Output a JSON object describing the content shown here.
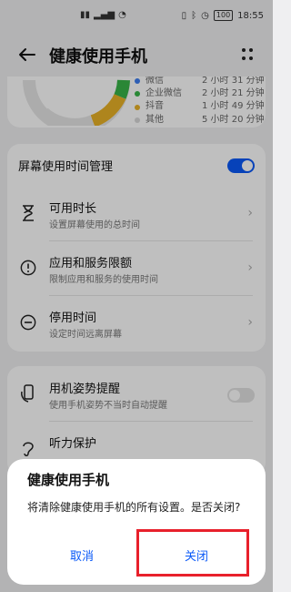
{
  "status_bar": {
    "left_icons": [
      "sim-icon",
      "signal-icon",
      "wifi-icon"
    ],
    "battery": "100",
    "time": "18:55"
  },
  "header": {
    "title": "健康使用手机",
    "back_icon": "back-arrow-icon",
    "more_icon": "more-icon"
  },
  "usage_legend": [
    {
      "name": "微信",
      "time": "2 小时 31 分钟",
      "color": "#3c7cf0"
    },
    {
      "name": "企业微信",
      "time": "2 小时 21 分钟",
      "color": "#38b449"
    },
    {
      "name": "抖音",
      "time": "1 小时 49 分钟",
      "color": "#e9b227"
    },
    {
      "name": "其他",
      "time": "5 小时 20 分钟",
      "color": "#d9d9d9"
    }
  ],
  "screen_time": {
    "label": "屏幕使用时间管理",
    "toggle_on": true,
    "items": [
      {
        "title": "可用时长",
        "desc": "设置屏幕使用的总时间",
        "icon": "hourglass-icon"
      },
      {
        "title": "应用和服务限额",
        "desc": "限制应用和服务的使用时间",
        "icon": "alert-circle-icon"
      },
      {
        "title": "停用时间",
        "desc": "设定时间远离屏幕",
        "icon": "minus-circle-icon"
      }
    ]
  },
  "other_settings": {
    "posture": {
      "title": "用机姿势提醒",
      "desc": "使用手机姿势不当时自动提醒",
      "toggle_on": false
    },
    "hearing": {
      "title": "听力保护"
    }
  },
  "dialog": {
    "title": "健康使用手机",
    "message": "将清除健康使用手机的所有设置。是否关闭?",
    "cancel_label": "取消",
    "confirm_label": "关闭",
    "highlight_color": "#e8202b"
  }
}
